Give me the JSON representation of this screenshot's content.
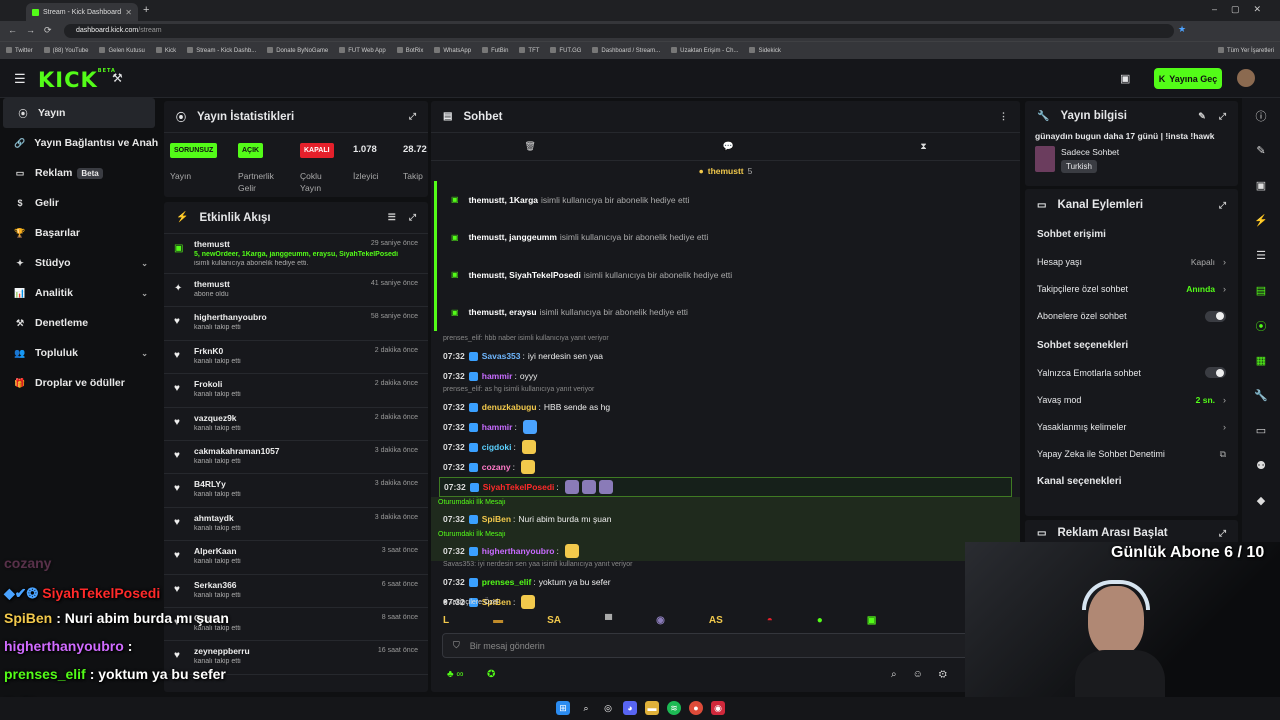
{
  "browser": {
    "tab_title": "Stream - Kick Dashboard",
    "url_host": "dashboard.kick.com",
    "url_path": "/stream",
    "bookmarks": [
      "Twitter",
      "(88) YouTube",
      "Gelen Kutusu",
      "Kick",
      "Stream - Kick Dashb...",
      "Donate ByNoGame",
      "FUT Web App",
      "BotRix",
      "WhatsApp",
      "FutBin",
      "TFT",
      "FUT.GG",
      "Dashboard / Stream...",
      "Uzaktan Erişim - Ch...",
      "Sidekick"
    ],
    "bookmarks_all": "Tüm Yer İşaretleri"
  },
  "header": {
    "logo": "KICK",
    "logo_tag": "BETA",
    "go_live": "Yayına Geç"
  },
  "sidebar": {
    "items": [
      {
        "label": "Yayın",
        "icon": "broadcast-icon"
      },
      {
        "label": "Yayın Bağlantısı ve Anahtarı",
        "icon": "link-icon"
      },
      {
        "label": "Reklam",
        "icon": "ad-icon",
        "badge": "Beta"
      },
      {
        "label": "Gelir",
        "icon": "money-icon"
      },
      {
        "label": "Başarılar",
        "icon": "trophy-icon"
      },
      {
        "label": "Stüdyo",
        "icon": "studio-icon"
      },
      {
        "label": "Analitik",
        "icon": "chart-icon"
      },
      {
        "label": "Denetleme",
        "icon": "hammer-icon"
      },
      {
        "label": "Topluluk",
        "icon": "community-icon"
      },
      {
        "label": "Droplar ve ödüller",
        "icon": "gift-icon"
      }
    ]
  },
  "stats": {
    "title": "Yayın İstatistikleri",
    "items": [
      {
        "badge": "SORUNSUZ",
        "label": "Yayın"
      },
      {
        "badge": "AÇIK",
        "label": "Partnerlik Gelir Programı"
      },
      {
        "badge": "KAPALI",
        "label": "Çoklu Yayın"
      },
      {
        "value": "1.078",
        "label": "İzleyici"
      },
      {
        "value": "28.72",
        "label": "Takip"
      }
    ]
  },
  "activity": {
    "title": "Etkinlik Akışı",
    "events": [
      {
        "name": "themustt",
        "sub_green": "5, newOrdeer, 1Karga, janggeumm, eraysu, SiyahTekelPosedi",
        "sub": "isimli kullanıcıya abonelik hediye etti.",
        "time": "29 saniye önce"
      },
      {
        "name": "themustt",
        "sub": "abone oldu",
        "time": "41 saniye önce"
      },
      {
        "name": "higherthanyoubro",
        "sub": "kanalı takip etti",
        "time": "58 saniye önce"
      },
      {
        "name": "FrknK0",
        "sub": "kanalı takip etti",
        "time": "2 dakika önce"
      },
      {
        "name": "Frokoli",
        "sub": "kanalı takip etti",
        "time": "2 dakika önce"
      },
      {
        "name": "vazquez9k",
        "sub": "kanalı takip etti",
        "time": "2 dakika önce"
      },
      {
        "name": "cakmakahraman1057",
        "sub": "kanalı takip etti",
        "time": "3 dakika önce"
      },
      {
        "name": "B4RLYy",
        "sub": "kanalı takip etti",
        "time": "3 dakika önce"
      },
      {
        "name": "ahmtaydk",
        "sub": "kanalı takip etti",
        "time": "3 dakika önce"
      },
      {
        "name": "AlperKaan",
        "sub": "kanalı takip etti",
        "time": "3 saat önce"
      },
      {
        "name": "Serkan366",
        "sub": "kanalı takip etti",
        "time": "6 saat önce"
      },
      {
        "name": "Ozan3",
        "sub": "kanalı takip etti",
        "time": "8 saat önce"
      },
      {
        "name": "zeyneppberru",
        "sub": "kanalı takip etti",
        "time": "16 saat önce"
      }
    ]
  },
  "chat": {
    "title": "Sohbet",
    "pinned_user": "themustt",
    "pinned_count": "5",
    "sub_gifts": [
      {
        "user": "themustt, 1Karga",
        "text": "isimli kullanıcıya bir abonelik hediye etti"
      },
      {
        "user": "themustt, janggeumm",
        "text": "isimli kullanıcıya bir abonelik hediye etti"
      },
      {
        "user": "themustt, SiyahTekelPosedi",
        "text": "isimli kullanıcıya bir abonelik hediye etti"
      },
      {
        "user": "themustt, eraysu",
        "text": "isimli kullanıcıya bir abonelik hediye etti"
      }
    ],
    "reply1": "prenses_elif: hbb naber isimli kullanıcıya yanıt veriyor",
    "reply2": "prenses_elif: as hg isimli kullanıcıya yanıt veriyor",
    "reply3": "Savas353: iyi nerdesin sen yaa isimli kullanıcıya yanıt veriyor",
    "messages": [
      {
        "time": "07:32",
        "user": "Savas353",
        "color": "#6fb7ff",
        "text": "iyi nerdesin sen yaa"
      },
      {
        "time": "07:32",
        "user": "hammir",
        "color": "#c86bff",
        "text": "oyyy"
      },
      {
        "time": "07:32",
        "user": "denuzkabugu",
        "color": "#f2c94c",
        "text": "HBB sende as hg"
      },
      {
        "time": "07:32",
        "user": "hammir",
        "color": "#c86bff",
        "text": ""
      },
      {
        "time": "07:32",
        "user": "cigdoki",
        "color": "#5bd1ff",
        "text": ""
      },
      {
        "time": "07:32",
        "user": "cozany",
        "color": "#ff7ac8",
        "text": ""
      },
      {
        "time": "07:32",
        "user": "SiyahTekelPosedi",
        "color": "#ff2a2a",
        "text": ""
      },
      {
        "time": "07:32",
        "user": "SpiBen",
        "color": "#f2c94c",
        "text": "Nuri abim burda mı şuan"
      },
      {
        "time": "07:32",
        "user": "higherthanyoubro",
        "color": "#c86bff",
        "text": ""
      },
      {
        "time": "07:32",
        "user": "prenses_elif",
        "color": "#53fc18",
        "text": "yoktum ya bu sefer"
      },
      {
        "time": "07:32",
        "user": "SpiBen",
        "color": "#f2c94c",
        "text": ""
      }
    ],
    "first_msg_label": "Oturumdaki İlk Mesajı",
    "followers_only": "Takipçilere Özel",
    "placeholder": "Bir mesaj gönderin",
    "emote_labels": [
      "SA",
      "AS"
    ]
  },
  "stream_info": {
    "title": "Yayın bilgisi",
    "stream_title": "günaydın bugun daha 17 günü | !insta !hawk",
    "category": "Sadece Sohbet",
    "language": "Turkish"
  },
  "channel_actions": {
    "title": "Kanal Eylemleri",
    "access_title": "Sohbet erişimi",
    "rows1": [
      {
        "label": "Hesap yaşı",
        "value": "Kapalı"
      },
      {
        "label": "Takipçilere özel sohbet",
        "value": "Anında"
      },
      {
        "label": "Abonelere özel sohbet",
        "value": ""
      }
    ],
    "options_title": "Sohbet seçenekleri",
    "rows2": [
      {
        "label": "Yalnızca Emotlarla sohbet",
        "value": ""
      },
      {
        "label": "Yavaş mod",
        "value": "2 sn."
      },
      {
        "label": "Yasaklanmış kelimeler",
        "value": ""
      },
      {
        "label": "Yapay Zeka ile Sohbet Denetimi",
        "value": ""
      }
    ],
    "channel_options": "Kanal seçenekleri"
  },
  "ad_break": {
    "title": "Reklam Arası Başlat"
  },
  "overlay": {
    "sub_goal": "Günlük Abone 6 / 10",
    "chat": [
      {
        "user": "cozany",
        "color": "#ff7ac8",
        "text": ""
      },
      {
        "user": "SiyahTekelPosedi",
        "color": "#ff2a2a",
        "text": ""
      },
      {
        "user": "SpiBen",
        "color": "#f2c94c",
        "text": ": Nuri abim burda mı şuan"
      },
      {
        "user": "higherthanyoubro",
        "color": "#d06bff",
        "text": ":"
      },
      {
        "user": "prenses_elif",
        "color": "#53fc18",
        "text": ": yoktum ya bu sefer"
      },
      {
        "user": "SpiBen",
        "color": "#f2c94c",
        "text": ":"
      }
    ]
  },
  "colors": {
    "accent": "#53fc18",
    "panel": "#17181c",
    "bg": "#0f1012",
    "danger": "#e5202b"
  }
}
